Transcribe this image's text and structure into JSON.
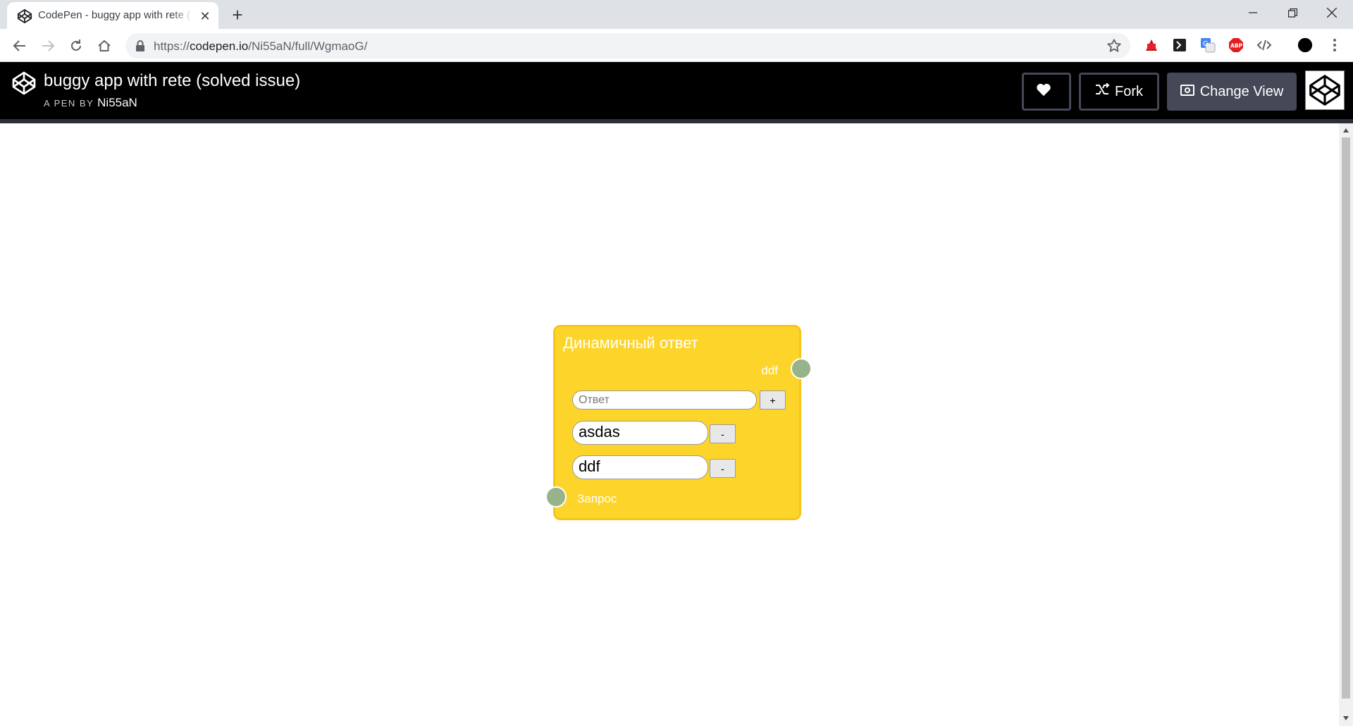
{
  "browser": {
    "tab": {
      "title": "CodePen - buggy app with rete (",
      "favicon": "codepen-icon",
      "close_glyph": "✕"
    },
    "new_tab_glyph": "+",
    "window_controls": [
      "minimize-icon",
      "restore-icon",
      "close-icon"
    ],
    "url": {
      "scheme": "https://",
      "host": "codepen.io",
      "path": "/Ni55aN/full/WgmaoG/"
    },
    "extensions": [
      "acrobat-icon",
      "terminal-icon",
      "google-translate-icon",
      "adblock-icon",
      "code-icon",
      "profile-icon",
      "menu-icon"
    ]
  },
  "codepen": {
    "pen_title": "buggy app with rete (solved issue)",
    "pen_by_label": "A PEN BY",
    "author": "Ni55aN",
    "fork_label": "Fork",
    "change_view_label": "Change View"
  },
  "node": {
    "title": "Динамичный ответ",
    "output_label": "ddf",
    "answer_placeholder": "Ответ",
    "add_label": "+",
    "rows": [
      {
        "value": "asdas",
        "remove_label": "-"
      },
      {
        "value": "ddf",
        "remove_label": "-"
      }
    ],
    "input_label": "Запрос"
  },
  "colors": {
    "node_fill": "#fdd52a",
    "node_border": "#f5c41a",
    "socket": "#96b38a",
    "header_bg": "#000000",
    "button_bg": "#444857"
  }
}
